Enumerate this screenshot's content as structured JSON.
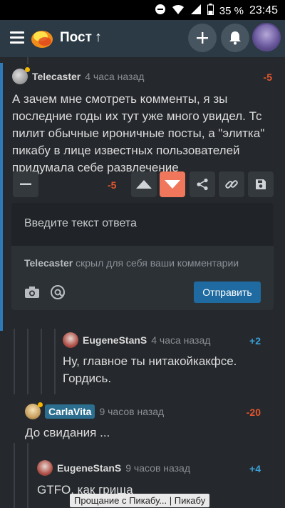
{
  "status_bar": {
    "battery": "35 %",
    "time": "23:45"
  },
  "app_bar": {
    "title": "Пост",
    "up_arrow": "↑"
  },
  "comments": [
    {
      "user": "Telecaster",
      "time": "4 часа назад",
      "score": "-5",
      "text": "А зачем мне смотреть комменты, я зы последние годы их тут уже много увидел. Тс пилит обычные ироничные посты, а \"элитка\" пикабу в лице известных пользователей придумала себе развлечение"
    },
    {
      "user": "EugeneStanS",
      "time": "4 часа назад",
      "score": "+2",
      "text": "Ну, главное ты нитакойкакфсе. Гордись."
    },
    {
      "user": "CarlaVita",
      "time": "9 часов назад",
      "score": "-20",
      "text": "До свидания ..."
    },
    {
      "user": "EugeneStanS",
      "time": "9 часов назад",
      "score": "+4",
      "text": "GTFO, как грища"
    }
  ],
  "vote_bar": {
    "score": "-5"
  },
  "reply": {
    "placeholder": "Введите текст ответа",
    "hidden_user": "Telecaster",
    "hidden_note": "скрыл для себя ваши комментарии",
    "send_label": "Отправить"
  },
  "tooltip": "Прощание с Пикабу... | Пикабу",
  "colors": {
    "accent": "#2e7ab8",
    "negative": "#e4562f",
    "positive": "#3aa0d8",
    "downvote": "#f0775b"
  },
  "icons": [
    "wifi-icon",
    "signal-icon",
    "battery-icon",
    "menu-icon",
    "pikabu-logo",
    "plus-icon",
    "bell-icon",
    "minus-icon",
    "upvote-icon",
    "downvote-icon",
    "share-icon",
    "link-icon",
    "save-icon",
    "camera-icon",
    "at-icon"
  ]
}
